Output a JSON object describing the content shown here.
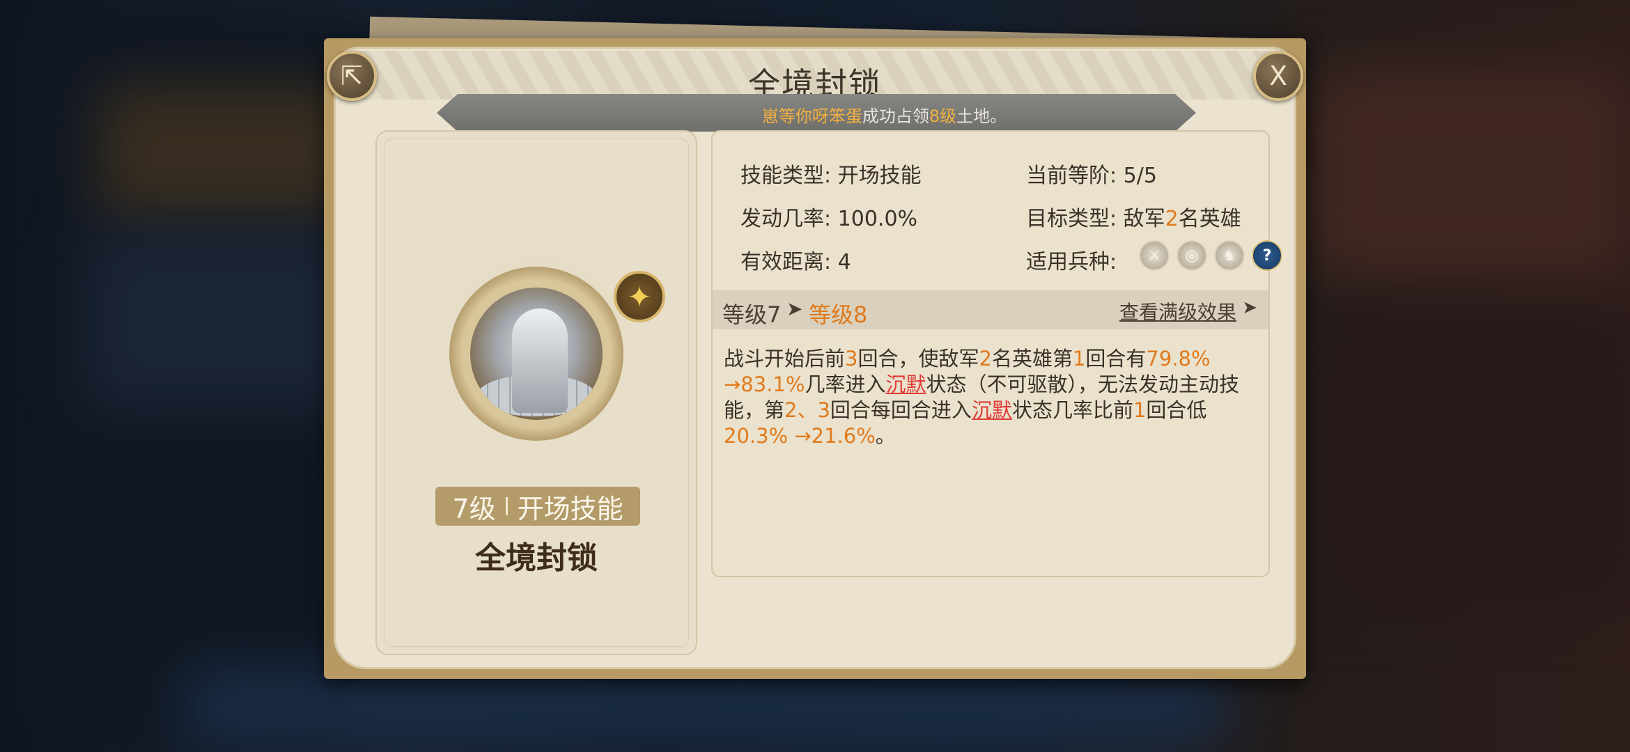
{
  "dialog": {
    "title": "全境封锁",
    "close_icon_glyph": "X",
    "share_icon_glyph": "⇱"
  },
  "notice": {
    "player_name": "崽等你呀笨蛋",
    "mid": "成功占领",
    "level": "8级",
    "tail": "土地。"
  },
  "skill": {
    "level_label": "7级",
    "type_label": "开场技能",
    "name": "全境封锁",
    "star_glyph": "✦"
  },
  "info": {
    "skill_type_label": "技能类型:",
    "skill_type_value": "开场技能",
    "current_rank_label": "当前等阶:",
    "current_rank_value": "5/5",
    "trigger_rate_label": "发动几率:",
    "trigger_rate_value": "100.0%",
    "target_type_label": "目标类型:",
    "target_type_pre": "敌军",
    "target_type_num": "2",
    "target_type_post": "名英雄",
    "range_label": "有效距离:",
    "range_value": "4",
    "troop_label": "适用兵种:",
    "troop_icons": [
      "sword-icon",
      "bow-target-icon",
      "horse-icon",
      "question-icon"
    ],
    "troop_glyphs": [
      "⚔",
      "◎",
      "♞",
      "?"
    ]
  },
  "level_bar": {
    "from": "等级7",
    "arrow": "➤",
    "to": "等级8",
    "max_link": "查看满级效果",
    "max_arrow": "➤"
  },
  "description": {
    "p1": "战斗开始后前",
    "n1": "3",
    "p2": "回合，使敌军",
    "n2": "2",
    "p3": "名英雄第",
    "n3": "1",
    "p4": "回合有",
    "v1": "79.8%",
    "v1b": "→83.1%",
    "p5": "几率进入",
    "status1": "沉默",
    "p6": "状态（不可驱散），无法发动主动技能，第",
    "n4": "2、3",
    "p7": "回合每回合进入",
    "status2": "沉默",
    "p8": "状态几率比前",
    "n5": "1",
    "p9": "回合低",
    "v2": "20.3%",
    "v2b": " →21.6%",
    "p10": "。"
  }
}
